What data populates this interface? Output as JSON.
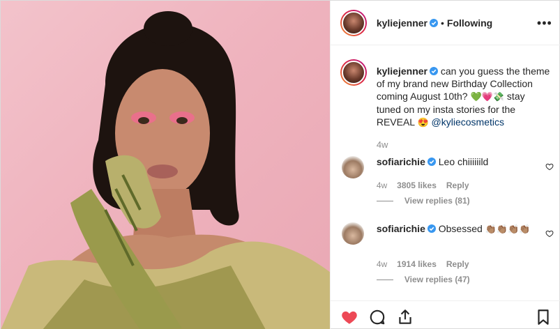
{
  "post": {
    "username": "kyliejenner",
    "follow_separator": "•",
    "follow_status": "Following",
    "more_label": "•••"
  },
  "caption": {
    "username": "kyliejenner",
    "text_part1": "can you guess the theme of my brand new Birthday Collection coming August 10th?",
    "emojis_1": "💚💗💸",
    "text_part2": " stay tuned on my insta stories for the REVEAL ",
    "emoji_2": "😍",
    "mention": "@kyliecosmetics",
    "time": "4w"
  },
  "comments": [
    {
      "username": "sofiarichie",
      "text": "Leo chiiiiiild",
      "time": "4w",
      "likes": "3805 likes",
      "reply_label": "Reply",
      "view_replies": "View replies (81)"
    },
    {
      "username": "sofiarichie",
      "text": "Obsessed",
      "emojis": "👏🏽👏🏽👏🏽👏🏽",
      "time": "4w",
      "likes": "1914 likes",
      "reply_label": "Reply",
      "view_replies": "View replies (47)"
    }
  ],
  "colors": {
    "like_red": "#ed4956",
    "verified_blue": "#3897f0",
    "mention_blue": "#003569",
    "muted_gray": "#8e8e8e"
  },
  "icons": {
    "like": "heart-icon",
    "comment": "comment-icon",
    "share": "share-icon",
    "save": "bookmark-icon",
    "comment_like": "heart-outline-icon",
    "verified": "verified-badge-icon"
  }
}
